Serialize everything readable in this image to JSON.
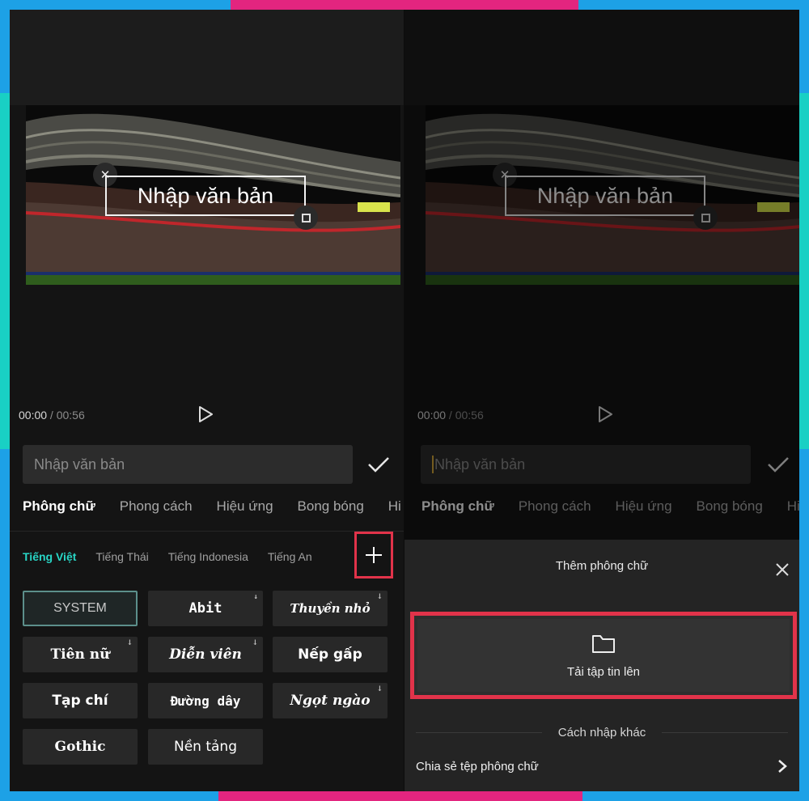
{
  "overlay_text": "Nhập văn bản",
  "player": {
    "current_time": "00:00",
    "separator": " / ",
    "duration": "00:56"
  },
  "editor": {
    "input_placeholder": "Nhập văn bản",
    "tabs": [
      "Phông chữ",
      "Phong cách",
      "Hiệu ứng",
      "Bong bóng",
      "Hi"
    ],
    "active_tab": "Phông chữ",
    "language_tabs": [
      "Tiếng Việt",
      "Tiếng Thái",
      "Tiếng Indonesia",
      "Tiếng An"
    ],
    "active_language": "Tiếng Việt",
    "fonts": [
      {
        "name": "SYSTEM",
        "download": false
      },
      {
        "name": "Abit",
        "download": true
      },
      {
        "name": "Thuyền nhỏ",
        "download": true
      },
      {
        "name": "Tiên nữ",
        "download": true
      },
      {
        "name": "Diễn viên",
        "download": true
      },
      {
        "name": "Nếp gấp",
        "download": false
      },
      {
        "name": "Tạp chí",
        "download": false
      },
      {
        "name": "Đường dây",
        "download": false
      },
      {
        "name": "Ngọt ngào",
        "download": true
      },
      {
        "name": "Gothic",
        "download": false
      },
      {
        "name": "Nền tảng",
        "download": false
      }
    ]
  },
  "add_font_sheet": {
    "title": "Thêm phông chữ",
    "upload_label": "Tải tập tin lên",
    "other_methods_label": "Cách nhập khác",
    "share_label": "Chia sẻ tệp phông chữ"
  },
  "colors": {
    "accent_teal": "#28d6c6",
    "highlight_red": "#e2334a",
    "frame_blue": "#1da1e6",
    "frame_pink": "#e3257f"
  }
}
